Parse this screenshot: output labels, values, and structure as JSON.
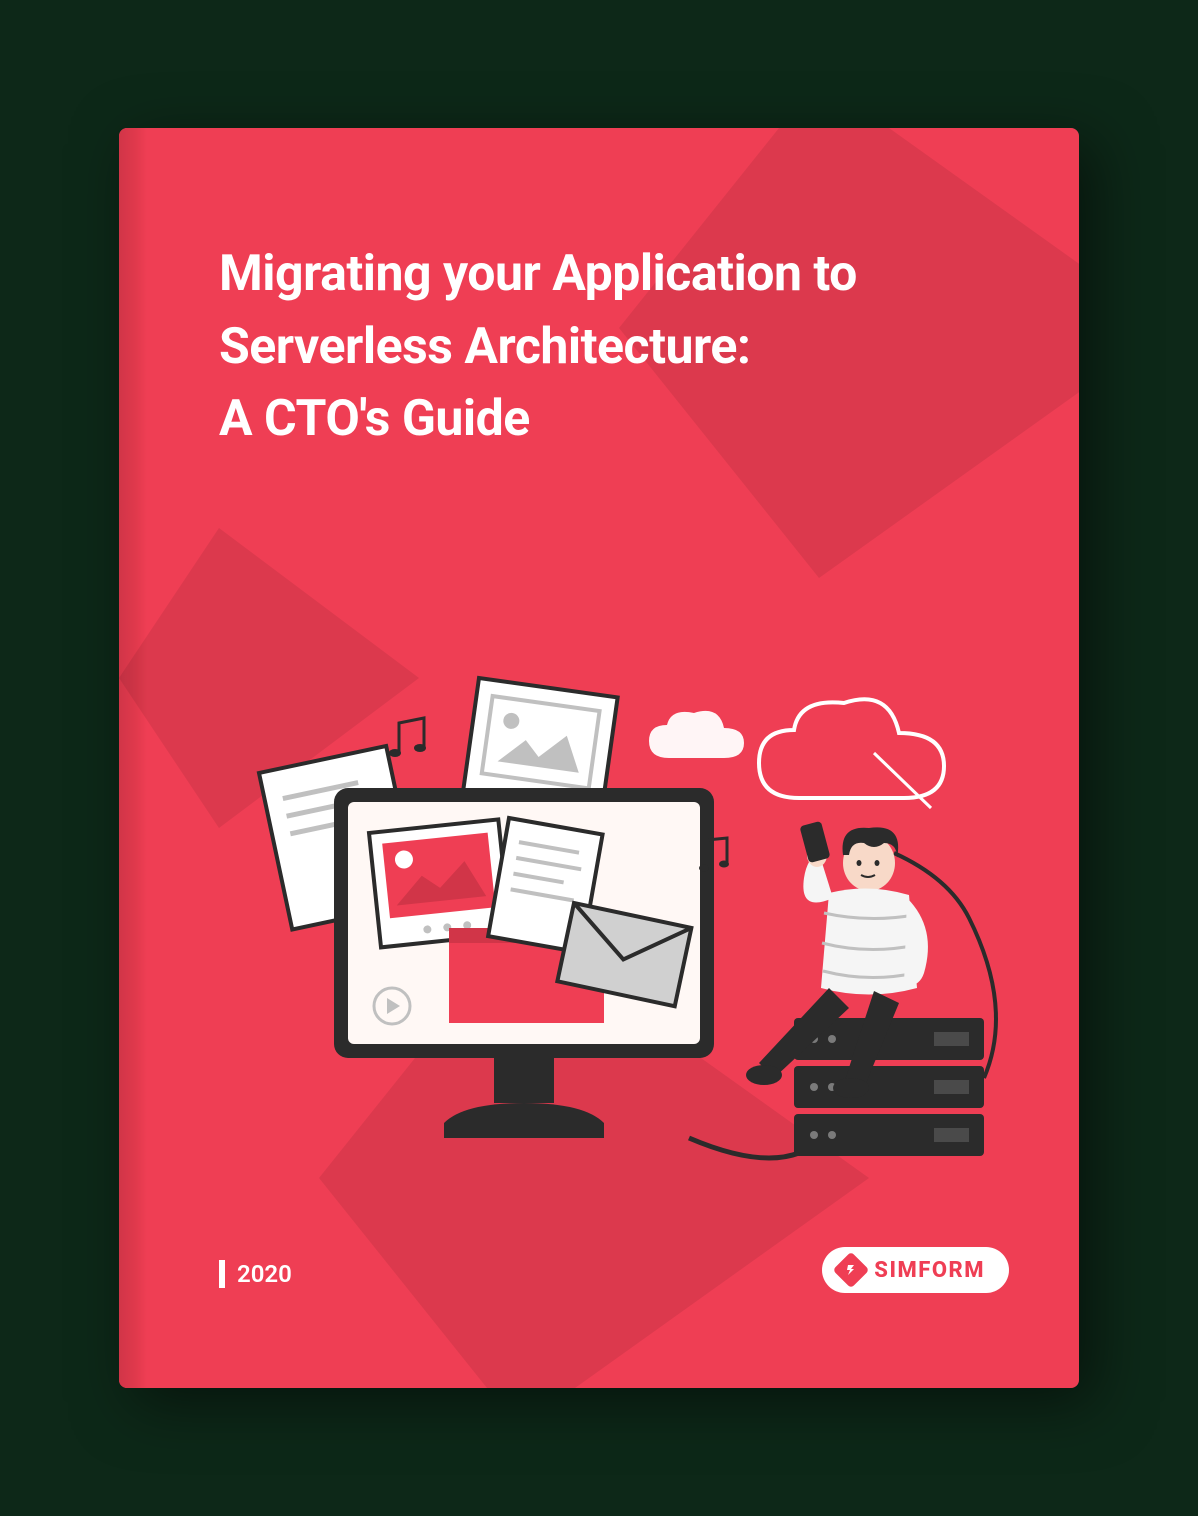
{
  "title_line1": "Migrating your Application to",
  "title_line2": "Serverless Architecture:",
  "title_line3": "A CTO's Guide",
  "year": "2020",
  "brand": "SIMFORM",
  "colors": {
    "cover": "#ef3e54",
    "dark": "#2b2b2b",
    "white": "#ffffff"
  }
}
